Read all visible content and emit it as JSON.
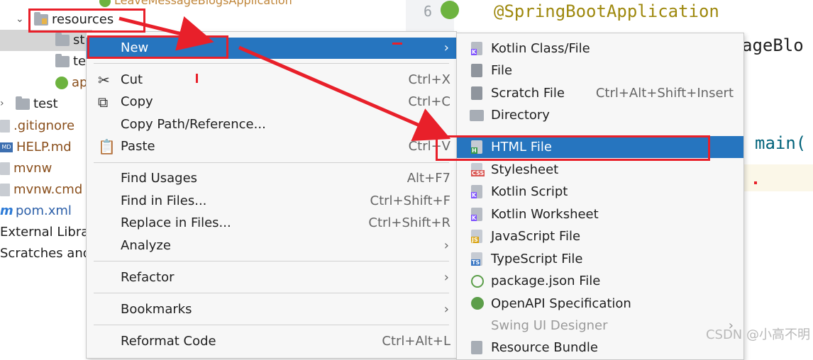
{
  "project_tree": {
    "top_item": "LeaveMessageBlogsApplication",
    "items": [
      {
        "label": "resources",
        "color": "#1f1f1f"
      },
      {
        "label": "st",
        "color": "#1f1f1f"
      },
      {
        "label": "te",
        "color": "#1f1f1f"
      },
      {
        "label": "ap",
        "color": "#8a4f1c"
      },
      {
        "label": "test",
        "color": "#1f1f1f"
      },
      {
        "label": ".gitignore",
        "color": "#8a4f1c"
      },
      {
        "label": "HELP.md",
        "color": "#8a4f1c"
      },
      {
        "label": "mvnw",
        "color": "#8a4f1c"
      },
      {
        "label": "mvnw.cmd",
        "color": "#8a4f1c"
      },
      {
        "label": "pom.xml",
        "color": "#2c5fa8"
      },
      {
        "label": "External Librar",
        "color": "#1f1f1f"
      },
      {
        "label": "Scratches and",
        "color": "#1f1f1f"
      }
    ]
  },
  "editor": {
    "line_number": "6",
    "annotation": "@SpringBootApplication",
    "class_fragment": "ageBlo",
    "method_fragment": "main("
  },
  "context_menu": {
    "items": [
      {
        "label": "New",
        "shortcut": "",
        "submenu": true
      },
      {
        "label": "Cut",
        "shortcut": "Ctrl+X"
      },
      {
        "label": "Copy",
        "shortcut": "Ctrl+C"
      },
      {
        "label": "Copy Path/Reference...",
        "shortcut": ""
      },
      {
        "label": "Paste",
        "shortcut": "Ctrl+V"
      },
      {
        "label": "Find Usages",
        "shortcut": "Alt+F7"
      },
      {
        "label": "Find in Files...",
        "shortcut": "Ctrl+Shift+F"
      },
      {
        "label": "Replace in Files...",
        "shortcut": "Ctrl+Shift+R"
      },
      {
        "label": "Analyze",
        "shortcut": "",
        "submenu": true
      },
      {
        "label": "Refactor",
        "shortcut": "",
        "submenu": true
      },
      {
        "label": "Bookmarks",
        "shortcut": "",
        "submenu": true
      },
      {
        "label": "Reformat Code",
        "shortcut": "Ctrl+Alt+L"
      }
    ]
  },
  "new_submenu": {
    "items": [
      {
        "label": "Kotlin Class/File",
        "shortcut": ""
      },
      {
        "label": "File",
        "shortcut": ""
      },
      {
        "label": "Scratch File",
        "shortcut": "Ctrl+Alt+Shift+Insert"
      },
      {
        "label": "Directory",
        "shortcut": ""
      },
      {
        "label": "HTML File",
        "shortcut": ""
      },
      {
        "label": "Stylesheet",
        "shortcut": ""
      },
      {
        "label": "Kotlin Script",
        "shortcut": ""
      },
      {
        "label": "Kotlin Worksheet",
        "shortcut": ""
      },
      {
        "label": "JavaScript File",
        "shortcut": ""
      },
      {
        "label": "TypeScript File",
        "shortcut": ""
      },
      {
        "label": "package.json File",
        "shortcut": ""
      },
      {
        "label": "OpenAPI Specification",
        "shortcut": ""
      },
      {
        "label": "Swing UI Designer",
        "shortcut": ""
      },
      {
        "label": "Resource Bundle",
        "shortcut": ""
      }
    ]
  },
  "icon_tags": {
    "html": "H",
    "css": "CSS",
    "js": "JS",
    "ts": "TS"
  },
  "colors": {
    "selection": "#2675bf",
    "annotation_red": "#e8202a",
    "spring_green": "#6db33f"
  },
  "watermark": "CSDN @小高不明"
}
